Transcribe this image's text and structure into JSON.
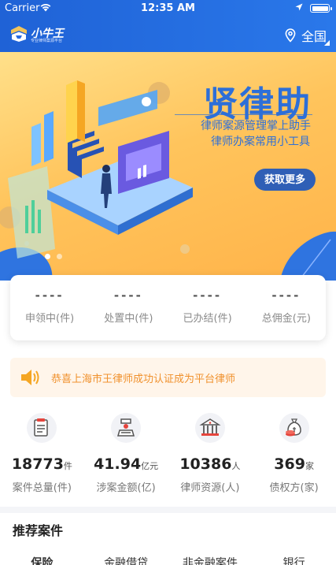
{
  "status_bar": {
    "carrier": "Carrier",
    "time": "12:35 AM"
  },
  "header": {
    "logo_text": "小牛王",
    "logo_sub": "专业律师案源平台",
    "region_label": "全国",
    "colors": {
      "bar": "#1f62d6"
    }
  },
  "banner": {
    "title": "贤律助",
    "subtitle_1": "律师案源管理掌上助手",
    "subtitle_2": "律师办案常用小工具",
    "button_label": "获取更多",
    "slide_count": 2,
    "active_slide": 1
  },
  "stats": [
    {
      "value": "----",
      "label": "申领中(件)"
    },
    {
      "value": "----",
      "label": "处置中(件)"
    },
    {
      "value": "----",
      "label": "已办结(件)"
    },
    {
      "value": "----",
      "label": "总佣金(元)"
    }
  ],
  "notice": {
    "text": "恭喜上海市王律师成功认证成为平台律师",
    "icon": "speaker-icon",
    "color": "#f0912d"
  },
  "features": [
    {
      "icon": "case-docs-icon",
      "value": "18773",
      "unit": "件",
      "label": "案件总量(件)"
    },
    {
      "icon": "money-scale-icon",
      "value": "41.94",
      "unit": "亿元",
      "label": "涉案金额(亿)"
    },
    {
      "icon": "law-building-icon",
      "value": "10386",
      "unit": "人",
      "label": "律师资源(人)"
    },
    {
      "icon": "money-bag-icon",
      "value": "369",
      "unit": "家",
      "label": "债权方(家)"
    }
  ],
  "recommend": {
    "title": "推荐案件",
    "tabs": [
      "保险",
      "金融借贷",
      "非金融案件",
      "银行"
    ]
  }
}
